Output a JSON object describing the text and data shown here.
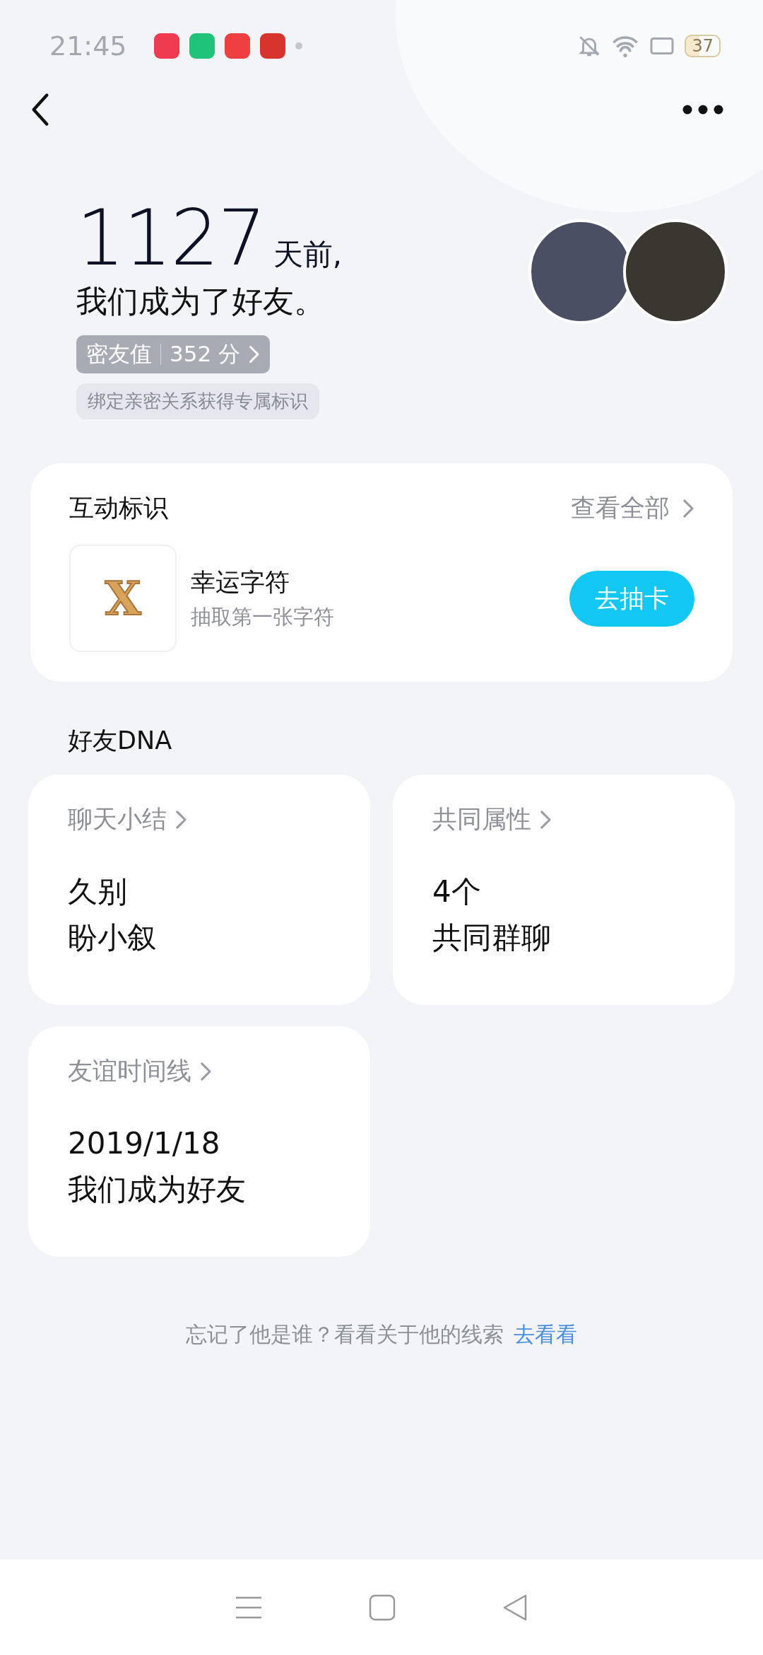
{
  "status_bar": {
    "time": "21:45",
    "battery": "37"
  },
  "header": {
    "days": "1127",
    "days_suffix": "天前,",
    "subtitle": "我们成为了好友。",
    "score_label": "密友值",
    "score_value": "352 分",
    "hint": "绑定亲密关系获得专属标识"
  },
  "badges_card": {
    "title": "互动标识",
    "see_all": "查看全部",
    "item": {
      "symbol": "X",
      "name": "幸运字符",
      "desc": "抽取第一张字符",
      "button": "去抽卡"
    }
  },
  "dna": {
    "title": "好友DNA",
    "cards": [
      {
        "title": "聊天小结",
        "lines": [
          "久别",
          "盼小叙"
        ]
      },
      {
        "title": "共同属性",
        "lines": [
          "4个",
          "共同群聊"
        ]
      },
      {
        "title": "友谊时间线",
        "lines": [
          "2019/1/18",
          "我们成为好友"
        ]
      }
    ]
  },
  "footer": {
    "text": "忘记了他是谁？看看关于他的线索",
    "link": "去看看"
  }
}
